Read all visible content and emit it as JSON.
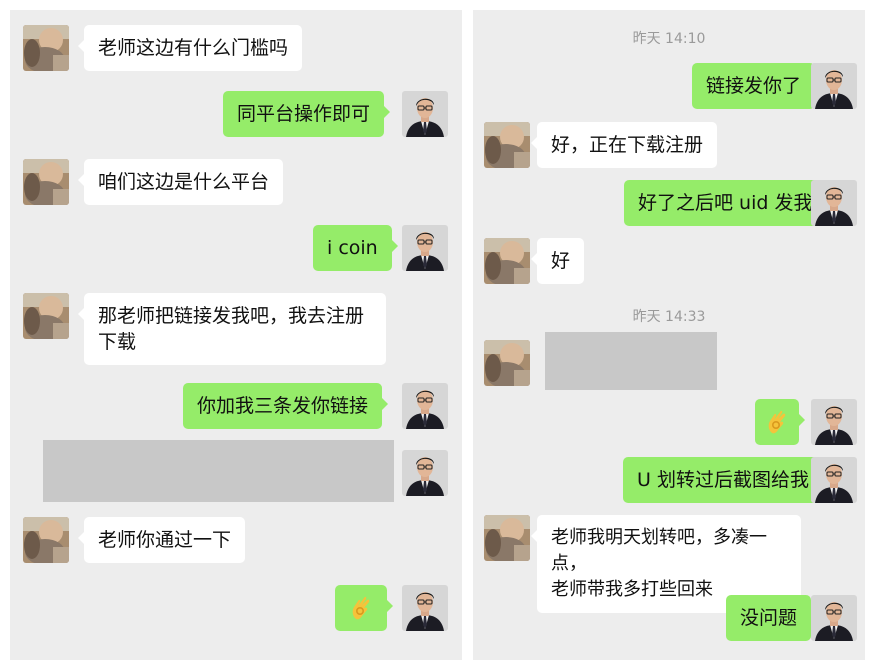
{
  "left_chat": {
    "messages": [
      {
        "text": "老师这边有什么门槛吗"
      },
      {
        "text": "同平台操作即可"
      },
      {
        "text": "咱们这边是什么平台"
      },
      {
        "text": "i coin"
      },
      {
        "line1": "那老师把链接发我吧，我去注册",
        "line2": "下载"
      },
      {
        "text": "你加我三条发你链接"
      },
      {
        "text": "[redacted image]"
      },
      {
        "text": "老师你通过一下"
      },
      {
        "emoji": "ok-hand-emoji"
      }
    ]
  },
  "right_chat": {
    "timestamps": [
      "昨天 14:10",
      "昨天 14:33"
    ],
    "messages": [
      {
        "text": "链接发你了"
      },
      {
        "text": "好，正在下载注册"
      },
      {
        "text": "好了之后吧 uid 发我"
      },
      {
        "text": "好"
      },
      {
        "text": "[redacted image]"
      },
      {
        "emoji": "ok-hand-emoji"
      },
      {
        "text": "U 划转过后截图给我"
      },
      {
        "line1": "老师我明天划转吧，多凑一点，",
        "line2": "老师带我多打些回来"
      },
      {
        "text": "没问题"
      }
    ]
  },
  "colors": {
    "background": "#ededed",
    "outgoing_bubble": "#95ec69",
    "incoming_bubble": "#ffffff",
    "timestamp_text": "#9a9a9a",
    "redacted": "#c8c8c8"
  },
  "icons": {
    "contact_avatar": "blurred-person-avatar",
    "own_avatar": "man-in-suit-avatar",
    "reaction": "ok-hand-emoji"
  }
}
